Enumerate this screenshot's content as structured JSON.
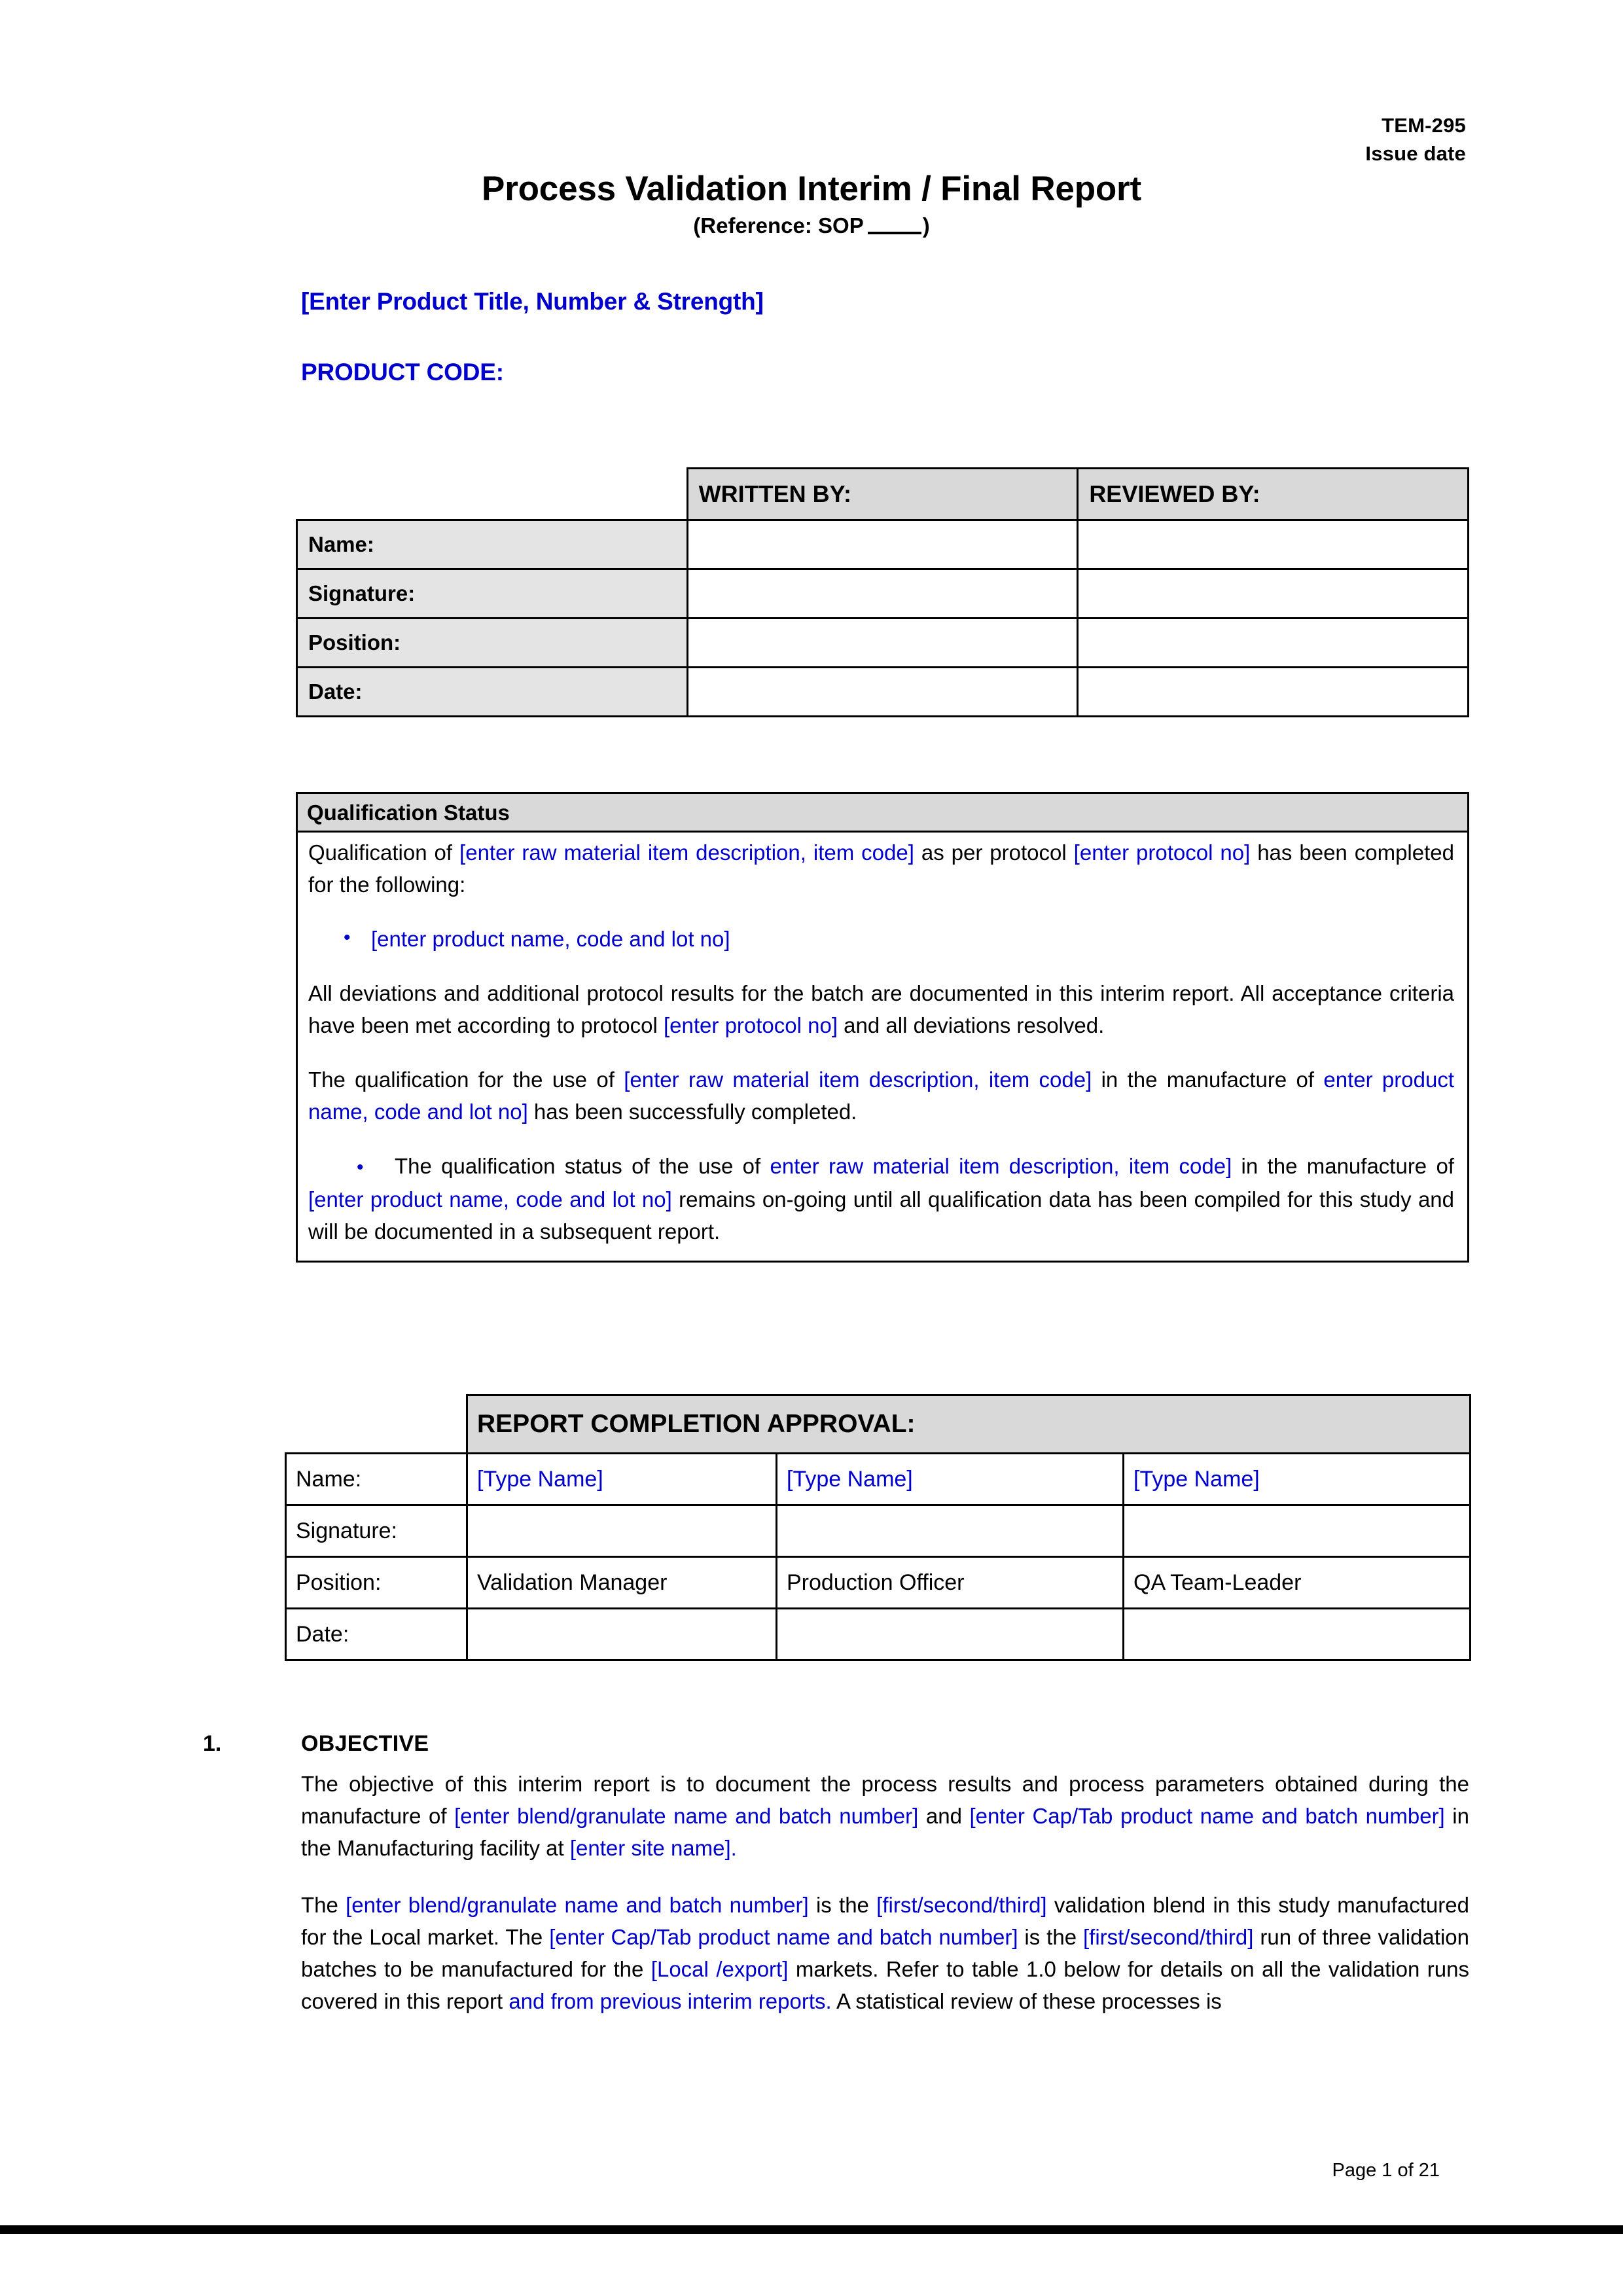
{
  "header": {
    "doc_code": "TEM-295",
    "issue_date_label": "Issue date"
  },
  "title": {
    "main": "Process Validation Interim / Final Report",
    "sub_prefix": "(Reference: SOP",
    "sub_suffix": ")"
  },
  "product": {
    "title_placeholder": "[Enter Product Title, Number & Strength]",
    "code_label": "PRODUCT CODE:"
  },
  "signature_table": {
    "corner": "",
    "columns": [
      "WRITTEN BY:",
      "REVIEWED BY:"
    ],
    "rows": [
      {
        "label": "Name:",
        "written_by": "",
        "reviewed_by": ""
      },
      {
        "label": "Signature:",
        "written_by": "",
        "reviewed_by": ""
      },
      {
        "label": "Position:",
        "written_by": "",
        "reviewed_by": ""
      },
      {
        "label": "Date:",
        "written_by": "",
        "reviewed_by": ""
      }
    ]
  },
  "qualification": {
    "heading": "Qualification Status",
    "para1": {
      "t1": "Qualification of ",
      "b1": "[enter raw material item description, item code]",
      "t2": " as per protocol ",
      "b2": "[enter protocol no]",
      "t3": " has been completed for the following:"
    },
    "bullet1": "[enter product name, code and lot no]",
    "para2": {
      "t1": "All deviations and additional protocol results for the batch are documented in this interim report. All acceptance criteria have been met according to protocol ",
      "b1": "[enter protocol no]",
      "t2": " and all deviations resolved."
    },
    "para3": {
      "t1": "The qualification for the use of ",
      "b1": "[enter raw material item description, item code]",
      "t2": " in the manufacture of ",
      "b2": "enter product name, code and lot no]",
      "t3": " has been successfully completed."
    },
    "para4": {
      "t1": "The qualification status of the use of ",
      "b1": "enter raw material item description, item code]",
      "t2": " in the manufacture of ",
      "b2": "[enter product name, code and lot no]",
      "t3": " remains on-going until all qualification data has been compiled for this study and will be documented in a subsequent report."
    }
  },
  "approval_table": {
    "heading": "REPORT COMPLETION APPROVAL:",
    "rows": [
      {
        "label": "Name:",
        "c1": "[Type Name]",
        "c2": "[Type Name]",
        "c3": "[Type Name]"
      },
      {
        "label": "Signature:",
        "c1": "",
        "c2": "",
        "c3": ""
      },
      {
        "label": "Position:",
        "c1": "Validation Manager",
        "c2": "Production Officer",
        "c3": "QA Team-Leader"
      },
      {
        "label": "Date:",
        "c1": "",
        "c2": "",
        "c3": ""
      }
    ]
  },
  "objective": {
    "number": "1.",
    "heading": "OBJECTIVE",
    "para1": {
      "t1": "The objective of this interim report is to document the process results and process parameters obtained during the manufacture of ",
      "b1": "[enter blend/granulate name and batch number]",
      "t2": " and ",
      "b2": "[enter Cap/Tab product name and batch number]",
      "t3": " in the Manufacturing facility at ",
      "b3": "[enter site name].",
      "t4": ""
    },
    "para2": {
      "t1": "The ",
      "b1": "[enter blend/granulate name and batch number]",
      "t2": " is the ",
      "b2": "[first/second/third]",
      "t3": " validation blend in this study manufactured for the Local market. The ",
      "b3": "[enter Cap/Tab product name and batch number]",
      "t4": " is the ",
      "b4": "[first/second/third]",
      "t5": " run of three validation batches to be manufactured for the ",
      "b5": "[Local /export]",
      "t6": " markets. Refer to table 1.0 below for details on all the validation runs covered in this report ",
      "b6": "and from previous interim reports.",
      "t7": "  A statistical review of these processes is"
    }
  },
  "footer": {
    "page_label": "Page 1 of 21"
  },
  "colors": {
    "blue_placeholder": "#0000CC",
    "header_shade": "#D9D9D9",
    "row_label_shade": "#E4E4E4",
    "border": "#000000"
  }
}
